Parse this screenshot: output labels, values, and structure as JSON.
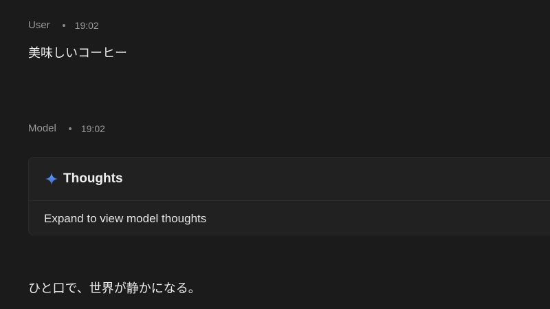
{
  "messages": {
    "user": {
      "role": "User",
      "time": "19:02",
      "text": "美味しいコーヒー"
    },
    "model": {
      "role": "Model",
      "time": "19:02",
      "thoughts": {
        "title": "Thoughts",
        "icon": "sparkle-icon",
        "expand_label": "Expand to view model thoughts"
      },
      "text": "ひと口で、世界が静かになる。"
    }
  },
  "colors": {
    "background": "#1b1b1c",
    "card_background": "#212122",
    "sparkle_top": "#5b9bf5",
    "sparkle_bottom": "#3b6fd8"
  }
}
